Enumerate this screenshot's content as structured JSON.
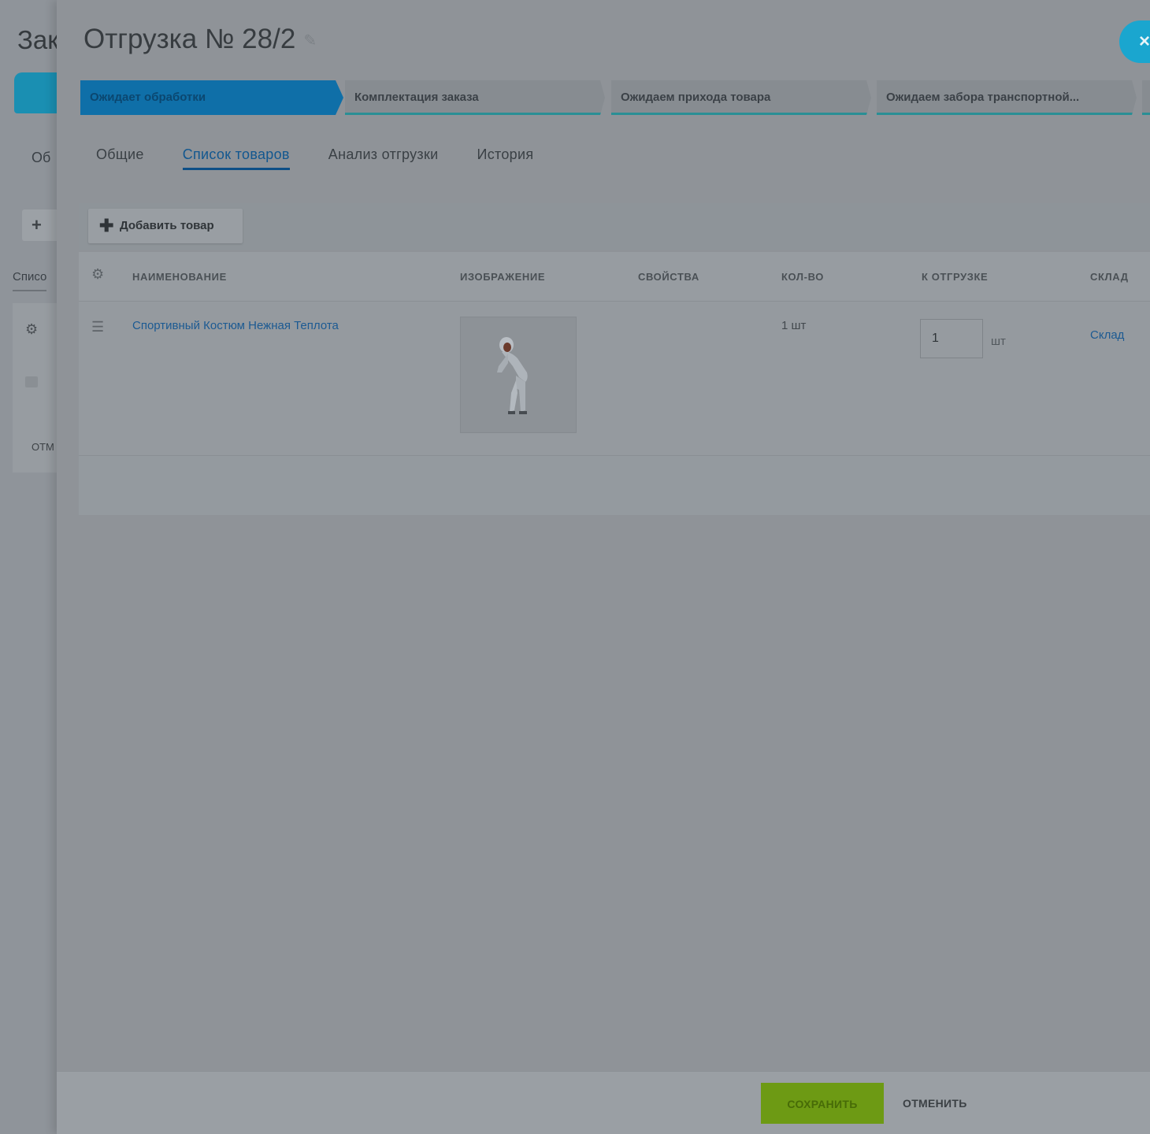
{
  "background_page": {
    "title": "Зак",
    "tab": "Об",
    "add_label": "+",
    "list_tab": "Списо",
    "cancel_label": "ОТМ",
    "gear_icon": "gear-icon",
    "image_icon": "image-icon"
  },
  "slider": {
    "title": "Отгрузка № 28/2",
    "edit_icon": "pencil-icon",
    "close_label": "×"
  },
  "stages": [
    {
      "label": "Ожидает обработки",
      "state": "active"
    },
    {
      "label": "Комплектация заказа",
      "state": "next"
    },
    {
      "label": "Ожидаем прихода товара",
      "state": "next"
    },
    {
      "label": "Ожидаем забора транспортной...",
      "state": "next"
    }
  ],
  "tabs": [
    {
      "label": "Общие",
      "active": false
    },
    {
      "label": "Список товаров",
      "active": true
    },
    {
      "label": "Анализ отгрузки",
      "active": false
    },
    {
      "label": "История",
      "active": false
    }
  ],
  "toolbar": {
    "add_label": "Добавить товар",
    "add_icon": "plus-icon"
  },
  "table": {
    "columns": [
      "НАИМЕНОВАНИЕ",
      "ИЗОБРАЖЕНИЕ",
      "СВОЙСТВА",
      "КОЛ-ВО",
      "К ОТГРУЗКЕ",
      "СКЛАД"
    ],
    "rows": [
      {
        "name": "Спортивный Костюм Нежная Теплота",
        "properties": "",
        "quantity": "1 шт",
        "to_ship": "1",
        "unit": "шт",
        "warehouse": "Склад"
      }
    ]
  },
  "footer": {
    "save_label": "СОХРАНИТЬ",
    "cancel_label": "ОТМЕНИТЬ"
  },
  "colors": {
    "accent": "#1aa6cf",
    "active_stage": "#0f6fa8",
    "save_button": "#6d9a14",
    "link": "#1c5a92"
  }
}
